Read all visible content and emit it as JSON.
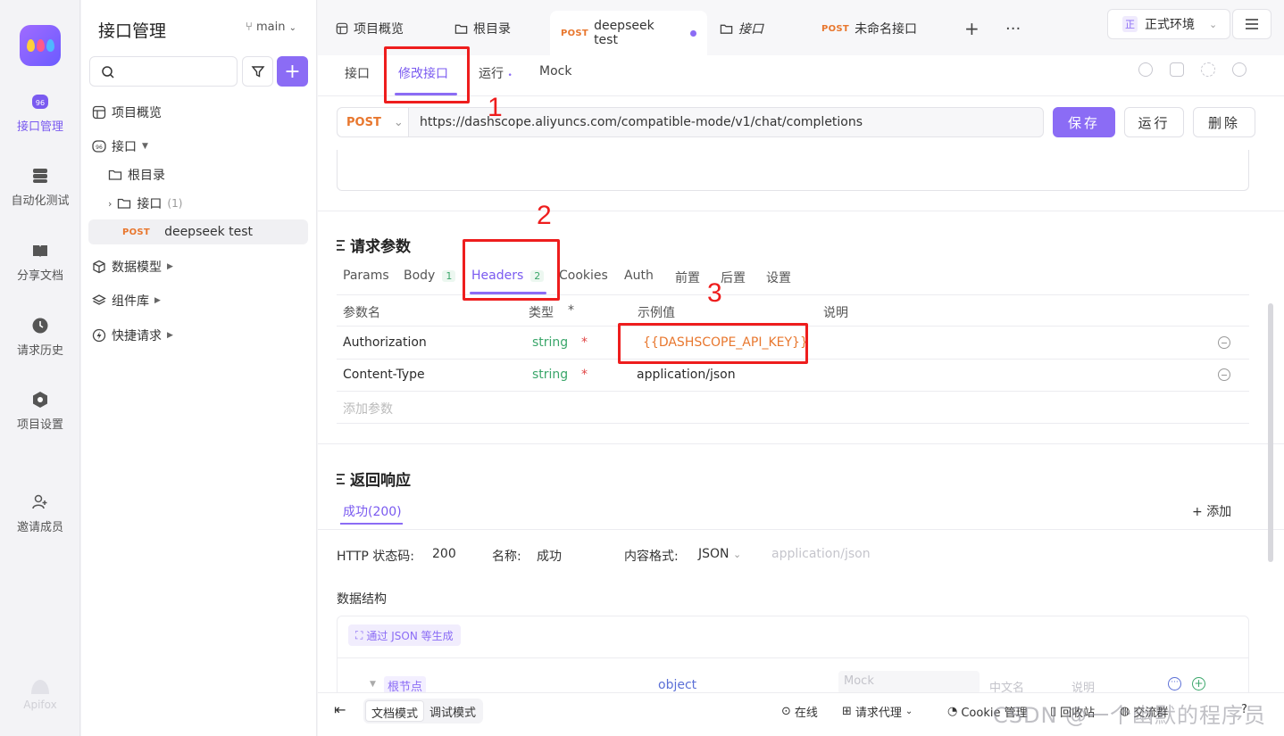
{
  "rail": {
    "items": [
      {
        "label": "接口管理",
        "icon": "interface-icon"
      },
      {
        "label": "自动化测试",
        "icon": "automation-icon"
      },
      {
        "label": "分享文档",
        "icon": "book-icon"
      },
      {
        "label": "请求历史",
        "icon": "clock-icon"
      },
      {
        "label": "项目设置",
        "icon": "settings-icon"
      },
      {
        "label": "邀请成员",
        "icon": "invite-icon"
      }
    ],
    "footer": "Apifox"
  },
  "sidebar": {
    "title": "接口管理",
    "branch": "main",
    "tree": {
      "overview": "项目概览",
      "interfaces": "接口",
      "root": "根目录",
      "folder": "接口",
      "folder_count": "(1)",
      "endpoint_method": "POST",
      "endpoint_name": "deepseek test",
      "models": "数据模型",
      "components": "组件库",
      "quick": "快捷请求"
    }
  },
  "tabs": {
    "items": [
      {
        "label": "项目概览"
      },
      {
        "label": "根目录"
      },
      {
        "method": "POST",
        "label": "deepseek test"
      },
      {
        "label": "接口"
      },
      {
        "method": "POST",
        "label": "未命名接口"
      }
    ],
    "env_badge": "正",
    "env": "正式环境"
  },
  "subtabs": [
    "接口",
    "修改接口",
    "运行",
    "Mock"
  ],
  "request": {
    "method": "POST",
    "url": "https://dashscope.aliyuncs.com/compatible-mode/v1/chat/completions",
    "save": "保存",
    "run": "运行",
    "delete": "删除"
  },
  "params_section": {
    "title": "请求参数",
    "tabs": [
      {
        "label": "Params"
      },
      {
        "label": "Body",
        "count": "1"
      },
      {
        "label": "Headers",
        "count": "2"
      },
      {
        "label": "Cookies"
      },
      {
        "label": "Auth"
      },
      {
        "label": "前置"
      },
      {
        "label": "后置"
      },
      {
        "label": "设置"
      }
    ],
    "headers": {
      "name": "参数名",
      "type": "类型",
      "required": "*",
      "example": "示例值",
      "desc": "说明"
    },
    "rows": [
      {
        "name": "Authorization",
        "type": "string",
        "required": "*",
        "example": "{{DASHSCOPE_API_KEY}}"
      },
      {
        "name": "Content-Type",
        "type": "string",
        "required": "*",
        "example": "application/json"
      }
    ],
    "add_placeholder": "添加参数"
  },
  "response_section": {
    "title": "返回响应",
    "tab": "成功(200)",
    "add": "添加",
    "status_label": "HTTP 状态码:",
    "status": "200",
    "name_label": "名称:",
    "name": "成功",
    "format_label": "内容格式:",
    "format": "JSON",
    "content_type": "application/json",
    "schema_label": "数据结构",
    "generate": "通过 JSON 等生成",
    "root": "根节点",
    "root_type": "object",
    "mock_placeholder": "Mock",
    "cn_name": "中文名",
    "desc": "说明"
  },
  "statusbar": {
    "doc_mode": "文档模式",
    "debug_mode": "调试模式",
    "online": "在线",
    "proxy": "请求代理",
    "cookie": "Cookie 管理",
    "trash": "回收站",
    "community": "交流群"
  },
  "annotations": [
    "1",
    "2",
    "3"
  ],
  "watermark": "CSDN @一个幽默的程序员",
  "colors": {
    "accent": "#8b6cf5",
    "post": "#e8772e",
    "string": "#3aa66a",
    "annotation": "#ee1d1d"
  }
}
